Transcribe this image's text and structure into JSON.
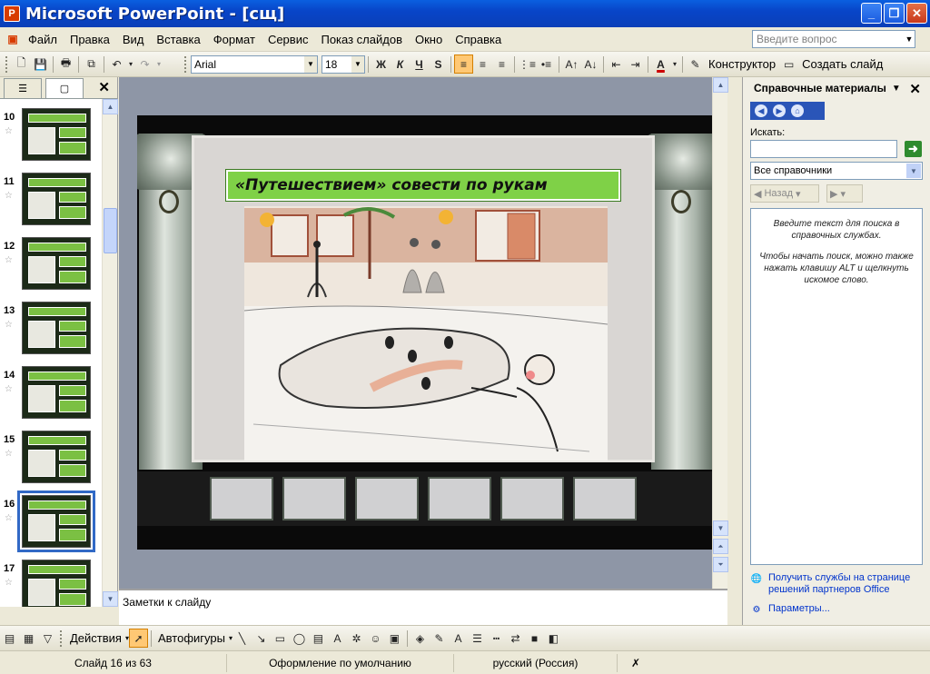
{
  "window": {
    "title": "Microsoft PowerPoint - [сщ]",
    "controls": [
      "_",
      "❐",
      "✕"
    ]
  },
  "menu": {
    "items": [
      "Файл",
      "Правка",
      "Вид",
      "Вставка",
      "Формат",
      "Сервис",
      "Показ слайдов",
      "Окно",
      "Справка"
    ],
    "ask_placeholder": "Введите вопрос"
  },
  "format_toolbar": {
    "font": "Arial",
    "size": "18",
    "bold": "Ж",
    "italic": "К",
    "underline": "Ч",
    "shadow": "S",
    "designer_label": "Конструктор",
    "new_slide_label": "Создать слайд"
  },
  "slides_pane": {
    "thumbnails": [
      {
        "number": "10"
      },
      {
        "number": "11"
      },
      {
        "number": "12"
      },
      {
        "number": "13"
      },
      {
        "number": "14"
      },
      {
        "number": "15"
      },
      {
        "number": "16",
        "selected": true
      },
      {
        "number": "17"
      }
    ],
    "star": "☆"
  },
  "slide": {
    "title": "«Путешествием» совести по рукам",
    "notes_placeholder": "Заметки к слайду"
  },
  "task_pane": {
    "title": "Справочные материалы",
    "search_label": "Искать:",
    "source": "Все справочники",
    "back_label": "Назад",
    "hint_1": "Введите текст для поиска в справочных службах.",
    "hint_2": "Чтобы начать поиск, можно также нажать клавишу ALT и щелкнуть искомое слово.",
    "link_partner": "Получить службы на странице решений партнеров Office",
    "link_params": "Параметры..."
  },
  "draw_toolbar": {
    "actions_label": "Действия",
    "autoshapes_label": "Автофигуры"
  },
  "status": {
    "slide_position": "Слайд 16 из 63",
    "design": "Оформление по умолчанию",
    "language": "русский (Россия)"
  },
  "colors": {
    "title_bar": "#0a5fe0",
    "slide_title_fill": "#7fd147",
    "selection": "#3169c6"
  }
}
